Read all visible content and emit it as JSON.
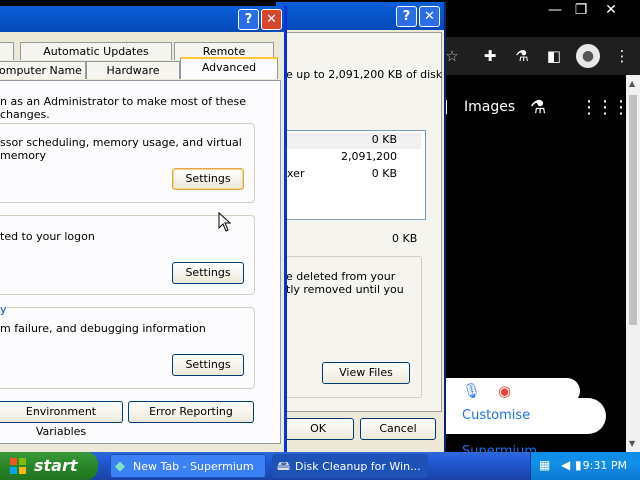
{
  "browser": {
    "nav_images": "Images",
    "customise": "Customise Supermium"
  },
  "disk_cleanup": {
    "description": "e up to 2,091,200 KB of disk",
    "rows": [
      {
        "label": "",
        "size": "0 KB"
      },
      {
        "label": "",
        "size": "2,091,200"
      },
      {
        "label": "xer",
        "size": "0 KB"
      }
    ],
    "total": "0 KB",
    "group_desc_1": "e deleted from your",
    "group_desc_2": "tly removed until you",
    "view_files": "View Files",
    "ok": "OK",
    "cancel": "Cancel"
  },
  "system_properties": {
    "tabs_top": [
      "Automatic Updates",
      "Remote"
    ],
    "tabs_bottom": [
      "omputer Name",
      "Hardware",
      "Advanced"
    ],
    "admin_note": "n as an Administrator to make most of these changes.",
    "perf_text": "ssor scheduling, memory usage, and virtual memory",
    "profile_text": "ted to your logon",
    "startup_label": "y",
    "startup_text": "m failure, and debugging information",
    "settings": "Settings",
    "env_vars": "Environment Variables",
    "error_reporting": "Error Reporting"
  },
  "taskbar": {
    "start": "start",
    "tasks": [
      {
        "label": "New Tab - Supermium"
      },
      {
        "label": "Disk Cleanup for Win..."
      }
    ],
    "clock": "9:31 PM"
  }
}
